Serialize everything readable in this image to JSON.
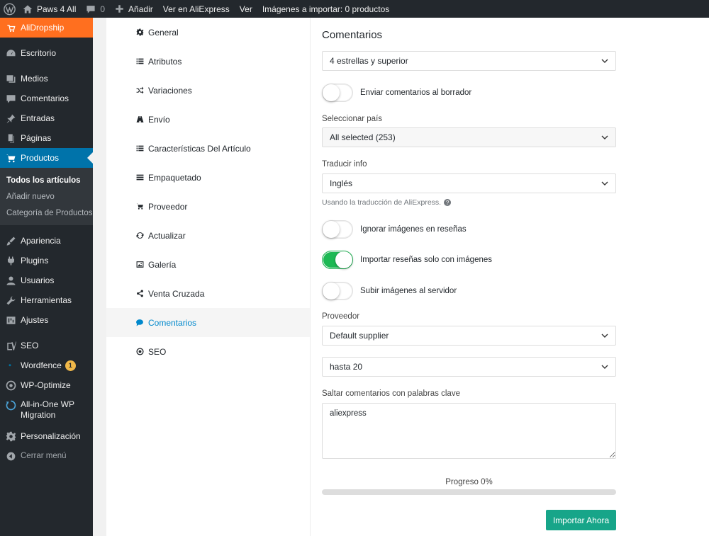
{
  "adminbar": {
    "site_name": "Paws 4 All",
    "comments_count": "0",
    "add_new": "Añadir",
    "view_aliexpress": "Ver en AliExpress",
    "view": "Ver",
    "import_status": "Imágenes a importar: 0 productos"
  },
  "sidebar": {
    "plugin": "AliDropship",
    "items": {
      "dashboard": "Escritorio",
      "media": "Medios",
      "comments": "Comentarios",
      "posts": "Entradas",
      "pages": "Páginas",
      "products": "Productos",
      "appearance": "Apariencia",
      "plugins": "Plugins",
      "users": "Usuarios",
      "tools": "Herramientas",
      "settings": "Ajustes",
      "seo": "SEO",
      "wordfence": "Wordfence",
      "wordfence_badge": "1",
      "wp_optimize": "WP-Optimize",
      "migration": "All-in-One WP Migration",
      "customization": "Personalización",
      "collapse": "Cerrar menú"
    },
    "products_sub": [
      "Todos los artículos",
      "Añadir nuevo",
      "Categoría de Productos"
    ]
  },
  "tabs": [
    {
      "label": "General",
      "icon": "gear-icon"
    },
    {
      "label": "Atributos",
      "icon": "list-icon"
    },
    {
      "label": "Variaciones",
      "icon": "shuffle-icon"
    },
    {
      "label": "Envío",
      "icon": "road-icon"
    },
    {
      "label": "Características Del Artículo",
      "icon": "list-icon"
    },
    {
      "label": "Empaquetado",
      "icon": "bars-icon"
    },
    {
      "label": "Proveedor",
      "icon": "cart-icon"
    },
    {
      "label": "Actualizar",
      "icon": "refresh-icon"
    },
    {
      "label": "Galería",
      "icon": "image-icon"
    },
    {
      "label": "Venta Cruzada",
      "icon": "share-icon"
    },
    {
      "label": "Comentarios",
      "icon": "comment-icon"
    },
    {
      "label": "SEO",
      "icon": "target-icon"
    }
  ],
  "form": {
    "title": "Comentarios",
    "rating_select": "4 estrellas y superior",
    "send_draft_label": "Enviar comentarios al borrador",
    "send_draft_on": false,
    "country_label": "Seleccionar país",
    "country_select": "All selected (253)",
    "translate_label": "Traducir info",
    "translate_select": "Inglés",
    "translate_hint": "Usando la traducción de AliExpress.",
    "ignore_images_label": "Ignorar imágenes en reseñas",
    "ignore_images_on": false,
    "only_images_label": "Importar reseñas solo con imágenes",
    "only_images_on": true,
    "upload_images_label": "Subir imágenes al servidor",
    "upload_images_on": false,
    "supplier_label": "Proveedor",
    "supplier_select": "Default supplier",
    "limit_select": "hasta 20",
    "skip_label": "Saltar comentarios con palabras clave",
    "skip_value": "aliexpress",
    "progress_label": "Progreso 0%",
    "progress_value": 0,
    "import_button": "Importar Ahora"
  },
  "colors": {
    "accent": "#17a589",
    "wp_blue": "#0073aa",
    "plugin_orange": "#ff6f1f",
    "toggle_on": "#1db954"
  }
}
